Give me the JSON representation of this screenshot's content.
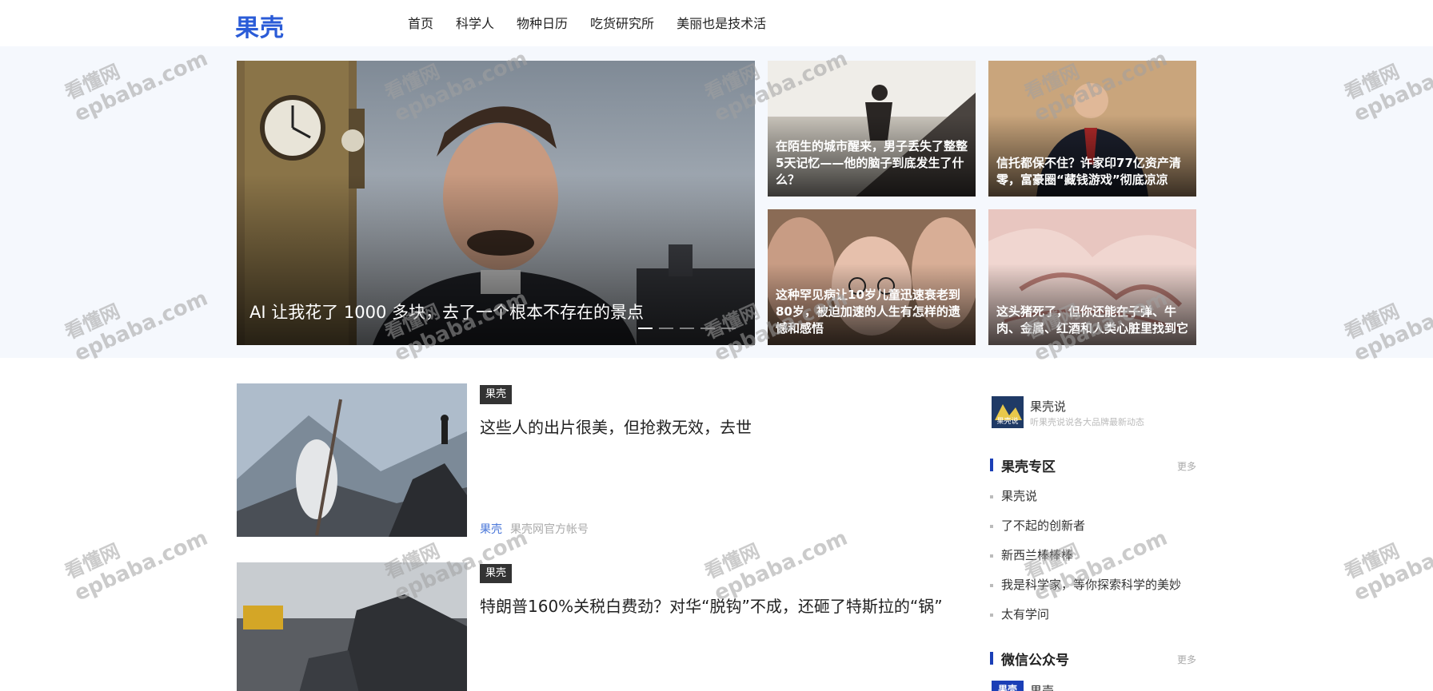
{
  "header": {
    "logo": "果壳",
    "nav": [
      "首页",
      "科学人",
      "物种日历",
      "吃货研究所",
      "美丽也是技术活"
    ]
  },
  "featured": {
    "main_title": "AI 让我花了 1000 多块，去了一个根本不存在的景点",
    "side_cards": [
      "在陌生的城市醒来，男子丢失了整整5天记忆——他的脑子到底发生了什么？",
      "信托都保不住？许家印77亿资产清零，富豪圈“藏钱游戏”彻底凉凉",
      "这种罕见病让10岁儿童迅速衰老到80岁，被迫加速的人生有怎样的遗憾和感悟",
      "这头猪死了，但你还能在子弹、牛肉、金属、红酒和人类心脏里找到它"
    ],
    "carousel_dots": 5,
    "active_dot": 0
  },
  "articles": [
    {
      "tag": "果壳",
      "title": "这些人的出片很美，但抢救无效，去世",
      "source": "果壳",
      "source_desc": "果壳网官方帐号"
    },
    {
      "tag": "果壳",
      "title": "特朗普160%关税白费劲？对华“脱钩”不成，还砸了特斯拉的“锅”"
    }
  ],
  "sidebar": {
    "brand": {
      "name": "果壳说",
      "desc": "听果壳说说各大品牌最新动态",
      "avatar_text": "果壳说"
    },
    "zone": {
      "title": "果壳专区",
      "more": "更多",
      "items": [
        "果壳说",
        "了不起的创新者",
        "新西兰棒棒棒",
        "我是科学家，等你探索科学的美妙",
        "太有学问"
      ]
    },
    "wechat": {
      "title": "微信公众号",
      "more": "更多",
      "first_name": "果壳",
      "first_avatar": "果壳"
    }
  },
  "watermark": {
    "cn": "看懂网",
    "en": "epbaba.com"
  },
  "colors": {
    "brand_blue": "#2a5bd7",
    "hero_band": "#f5f8fd",
    "section_bar": "#1b3fb6"
  }
}
